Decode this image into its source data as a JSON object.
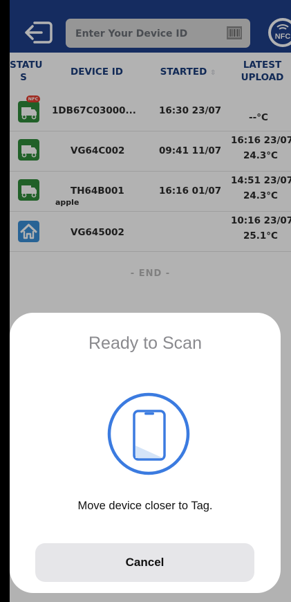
{
  "header": {
    "search_placeholder": "Enter Your Device ID",
    "nfc_label": "NFC"
  },
  "table": {
    "columns": {
      "status": "STATU S",
      "device_id": "DEVICE ID",
      "started": "STARTED",
      "latest_upload": "LATEST UPLOAD"
    },
    "rows": [
      {
        "status_icon": "truck-icon",
        "nfc_badge": "NFC",
        "device_id": "1DB67C03000...",
        "sub": "",
        "started": "16:30 23/07",
        "upload_time": "",
        "upload_temp": "--°C"
      },
      {
        "status_icon": "truck-icon",
        "nfc_badge": "",
        "device_id": "VG64C002",
        "sub": "",
        "started": "09:41 11/07",
        "upload_time": "16:16 23/07",
        "upload_temp": "24.3°C"
      },
      {
        "status_icon": "truck-icon",
        "nfc_badge": "",
        "device_id": "TH64B001",
        "sub": "apple",
        "started": "16:16 01/07",
        "upload_time": "14:51 23/07",
        "upload_temp": "24.3°C"
      },
      {
        "status_icon": "home-icon",
        "nfc_badge": "",
        "device_id": "VG645002",
        "sub": "",
        "started": "",
        "upload_time": "10:16 23/07",
        "upload_temp": "25.1°C"
      }
    ],
    "end_label": "- END -"
  },
  "sheet": {
    "title": "Ready to Scan",
    "message": "Move device closer to Tag.",
    "cancel_label": "Cancel"
  },
  "colors": {
    "header_bg": "#1f3f8a",
    "truck_green": "#2f8a3a",
    "home_blue": "#3a8fd6",
    "scan_ring": "#3b7be0"
  }
}
